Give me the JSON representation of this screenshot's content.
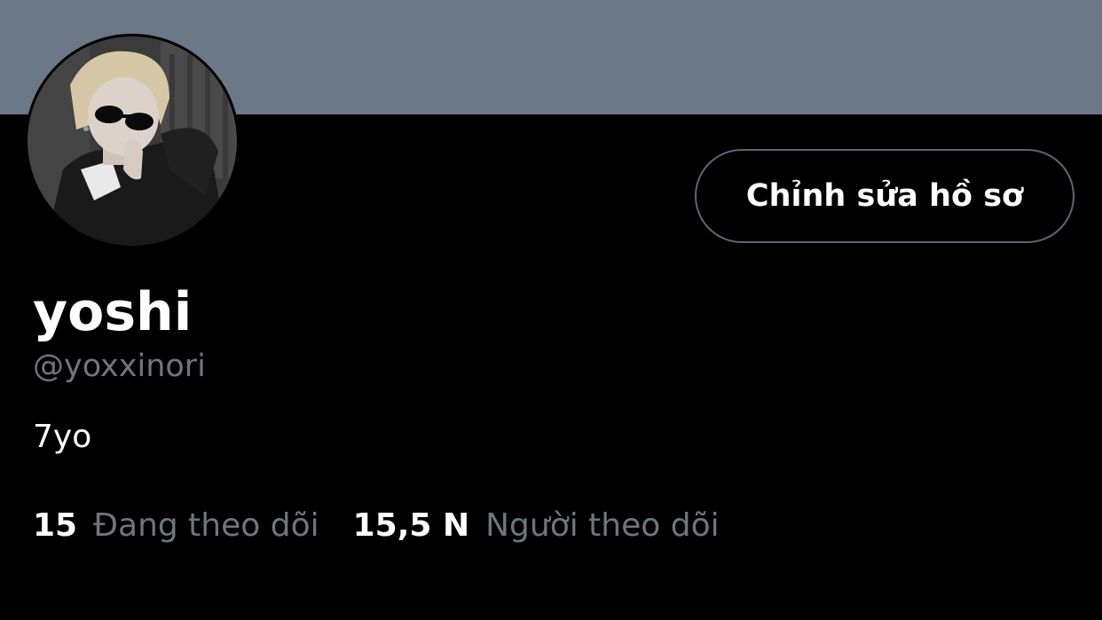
{
  "profile": {
    "display_name": "yoshi",
    "handle": "@yoxxinori",
    "bio": "7yo",
    "edit_button_label": "Chỉnh sửa hồ sơ",
    "following_count": "15",
    "following_label": "Đang theo dõi",
    "followers_count": "15,5 N",
    "followers_label": "Người theo dõi"
  },
  "colors": {
    "banner": "#6b7887",
    "background": "#000000",
    "primary_text": "#ffffff",
    "secondary_text": "#6e767d",
    "button_border": "#5b6671"
  },
  "icons": {
    "avatar": "profile-photo"
  }
}
